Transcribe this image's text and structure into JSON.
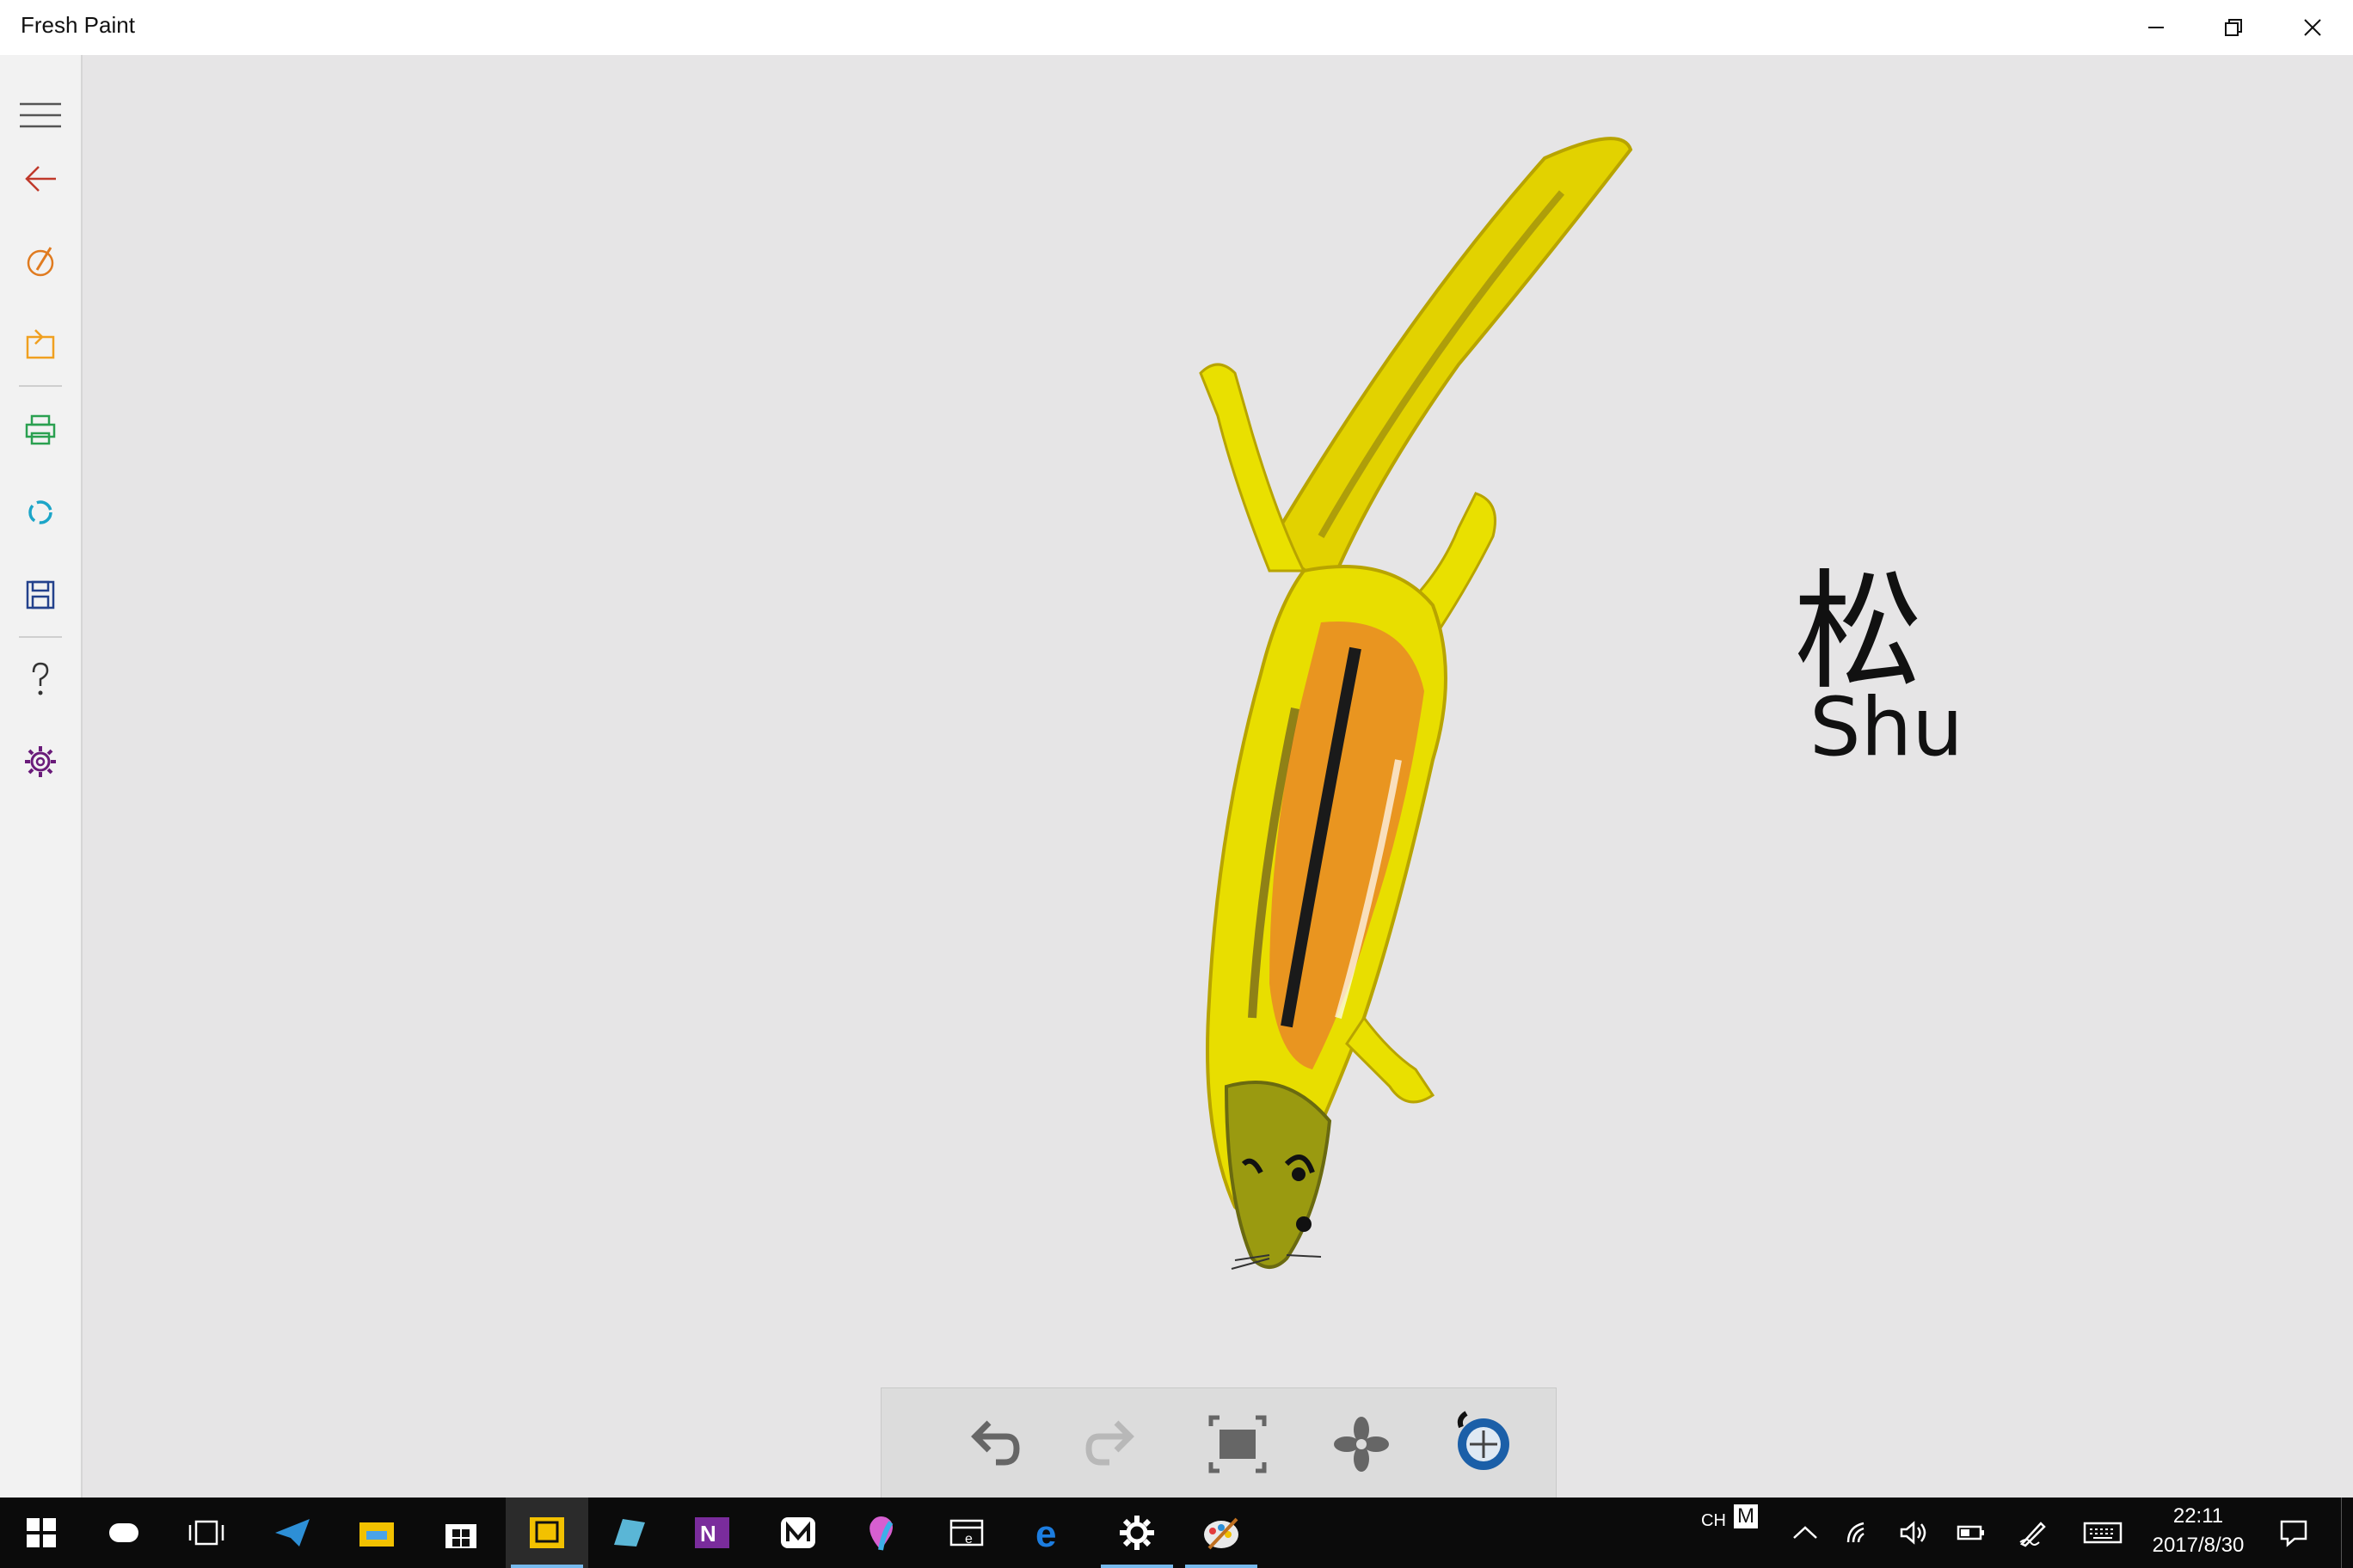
{
  "window": {
    "title": "Fresh Paint"
  },
  "sidebar": {
    "items": [
      {
        "name": "menu-icon",
        "color": "#555555"
      },
      {
        "name": "back-arrow-icon",
        "color": "#c0392b"
      },
      {
        "name": "paint-brush-icon",
        "color": "#e07b20"
      },
      {
        "name": "import-icon",
        "color": "#f0a020"
      },
      {
        "name": "print-icon",
        "color": "#2aa050"
      },
      {
        "name": "share-icon",
        "color": "#1ca5c8"
      },
      {
        "name": "save-icon",
        "color": "#23418c"
      },
      {
        "name": "help-icon",
        "color": "#333333"
      },
      {
        "name": "settings-icon",
        "color": "#6a1b7a"
      }
    ]
  },
  "canvas": {
    "caption_char": "松",
    "caption_latin": "Shu",
    "painting_subject": "squirrel"
  },
  "toolbar": {
    "buttons": [
      "undo-icon",
      "redo-icon",
      "fit-screen-icon",
      "dry-fan-icon",
      "tool-selector-icon"
    ]
  },
  "taskbar": {
    "apps": [
      "start-icon",
      "cortana-icon",
      "task-view-icon",
      "telegram-icon",
      "file-explorer-icon",
      "store-icon",
      "sketch-app-icon",
      "sticky-app-icon",
      "onenote-icon",
      "media-app-icon",
      "paint-balloon-icon",
      "news-app-icon",
      "edge-icon",
      "settings-gear-icon",
      "fresh-paint-icon"
    ],
    "ime": "CH",
    "ime_mode": "M",
    "time": "22:11",
    "date": "2017/8/30"
  }
}
